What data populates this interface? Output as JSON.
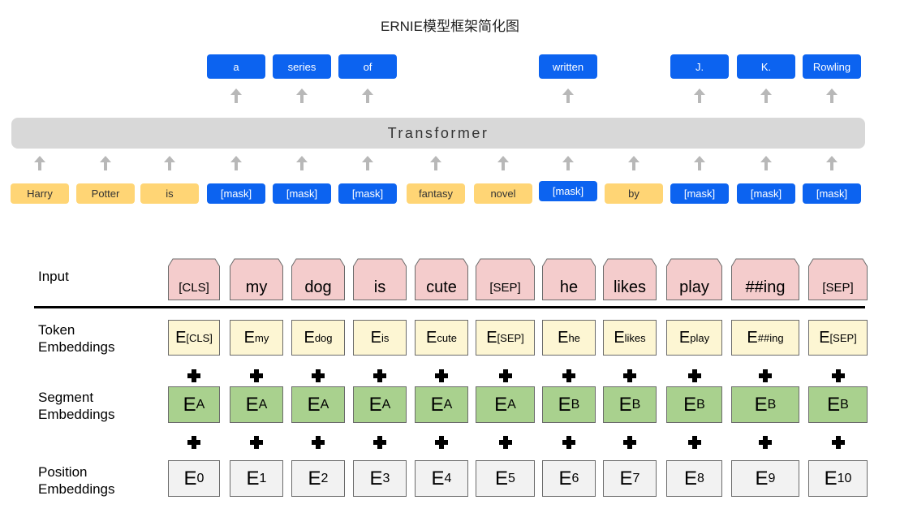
{
  "title": "ERNIE模型框架简化图",
  "transformer_label": "Transformer",
  "ernie_input_tokens": [
    {
      "text": "Harry",
      "kind": "plain"
    },
    {
      "text": "Potter",
      "kind": "plain"
    },
    {
      "text": "is",
      "kind": "plain"
    },
    {
      "text": "[mask]",
      "kind": "mask"
    },
    {
      "text": "[mask]",
      "kind": "mask"
    },
    {
      "text": "[mask]",
      "kind": "mask"
    },
    {
      "text": "fantasy",
      "kind": "plain"
    },
    {
      "text": "novel",
      "kind": "plain"
    },
    {
      "text": "[mask]",
      "kind": "mask"
    },
    {
      "text": "by",
      "kind": "plain"
    },
    {
      "text": "[mask]",
      "kind": "mask"
    },
    {
      "text": "[mask]",
      "kind": "mask"
    },
    {
      "text": "[mask]",
      "kind": "mask"
    }
  ],
  "ernie_outputs": [
    {
      "text": "a",
      "position": 3
    },
    {
      "text": "series",
      "position": 4
    },
    {
      "text": "of",
      "position": 5
    },
    {
      "text": "written",
      "position": 8
    },
    {
      "text": "J.",
      "position": 10
    },
    {
      "text": "K.",
      "position": 11
    },
    {
      "text": "Rowling",
      "position": 12
    }
  ],
  "colors": {
    "mask_blue": "#0c63f0",
    "plain_yellow": "#ffd575",
    "transformer_gray": "#d8d8d8",
    "input_pink": "#f4cccc",
    "token_cream": "#fdf6d3",
    "segment_green": "#a9d18e",
    "position_gray": "#f2f2f2"
  },
  "bert": {
    "row_labels": {
      "input": "Input",
      "token": [
        "Token",
        "Embeddings"
      ],
      "segment": [
        "Segment",
        "Embeddings"
      ],
      "position": [
        "Position",
        "Embeddings"
      ]
    },
    "inputs": [
      "[CLS]",
      "my",
      "dog",
      "is",
      "cute",
      "[SEP]",
      "he",
      "likes",
      "play",
      "##ing",
      "[SEP]"
    ],
    "token_embeddings": [
      {
        "base": "E",
        "sub": "[CLS]"
      },
      {
        "base": "E",
        "sub": "my"
      },
      {
        "base": "E",
        "sub": "dog"
      },
      {
        "base": "E",
        "sub": "is"
      },
      {
        "base": "E",
        "sub": "cute"
      },
      {
        "base": "E",
        "sub": "[SEP]"
      },
      {
        "base": "E",
        "sub": "he"
      },
      {
        "base": "E",
        "sub": "likes"
      },
      {
        "base": "E",
        "sub": "play"
      },
      {
        "base": "E",
        "sub": "##ing"
      },
      {
        "base": "E",
        "sub": "[SEP]"
      }
    ],
    "segment_embeddings": [
      {
        "base": "E",
        "sub": "A"
      },
      {
        "base": "E",
        "sub": "A"
      },
      {
        "base": "E",
        "sub": "A"
      },
      {
        "base": "E",
        "sub": "A"
      },
      {
        "base": "E",
        "sub": "A"
      },
      {
        "base": "E",
        "sub": "A"
      },
      {
        "base": "E",
        "sub": "B"
      },
      {
        "base": "E",
        "sub": "B"
      },
      {
        "base": "E",
        "sub": "B"
      },
      {
        "base": "E",
        "sub": "B"
      },
      {
        "base": "E",
        "sub": "B"
      }
    ],
    "position_embeddings": [
      {
        "base": "E",
        "sub": "0"
      },
      {
        "base": "E",
        "sub": "1"
      },
      {
        "base": "E",
        "sub": "2"
      },
      {
        "base": "E",
        "sub": "3"
      },
      {
        "base": "E",
        "sub": "4"
      },
      {
        "base": "E",
        "sub": "5"
      },
      {
        "base": "E",
        "sub": "6"
      },
      {
        "base": "E",
        "sub": "7"
      },
      {
        "base": "E",
        "sub": "8"
      },
      {
        "base": "E",
        "sub": "9"
      },
      {
        "base": "E",
        "sub": "10"
      }
    ],
    "operator_icon": "plus-icon"
  }
}
